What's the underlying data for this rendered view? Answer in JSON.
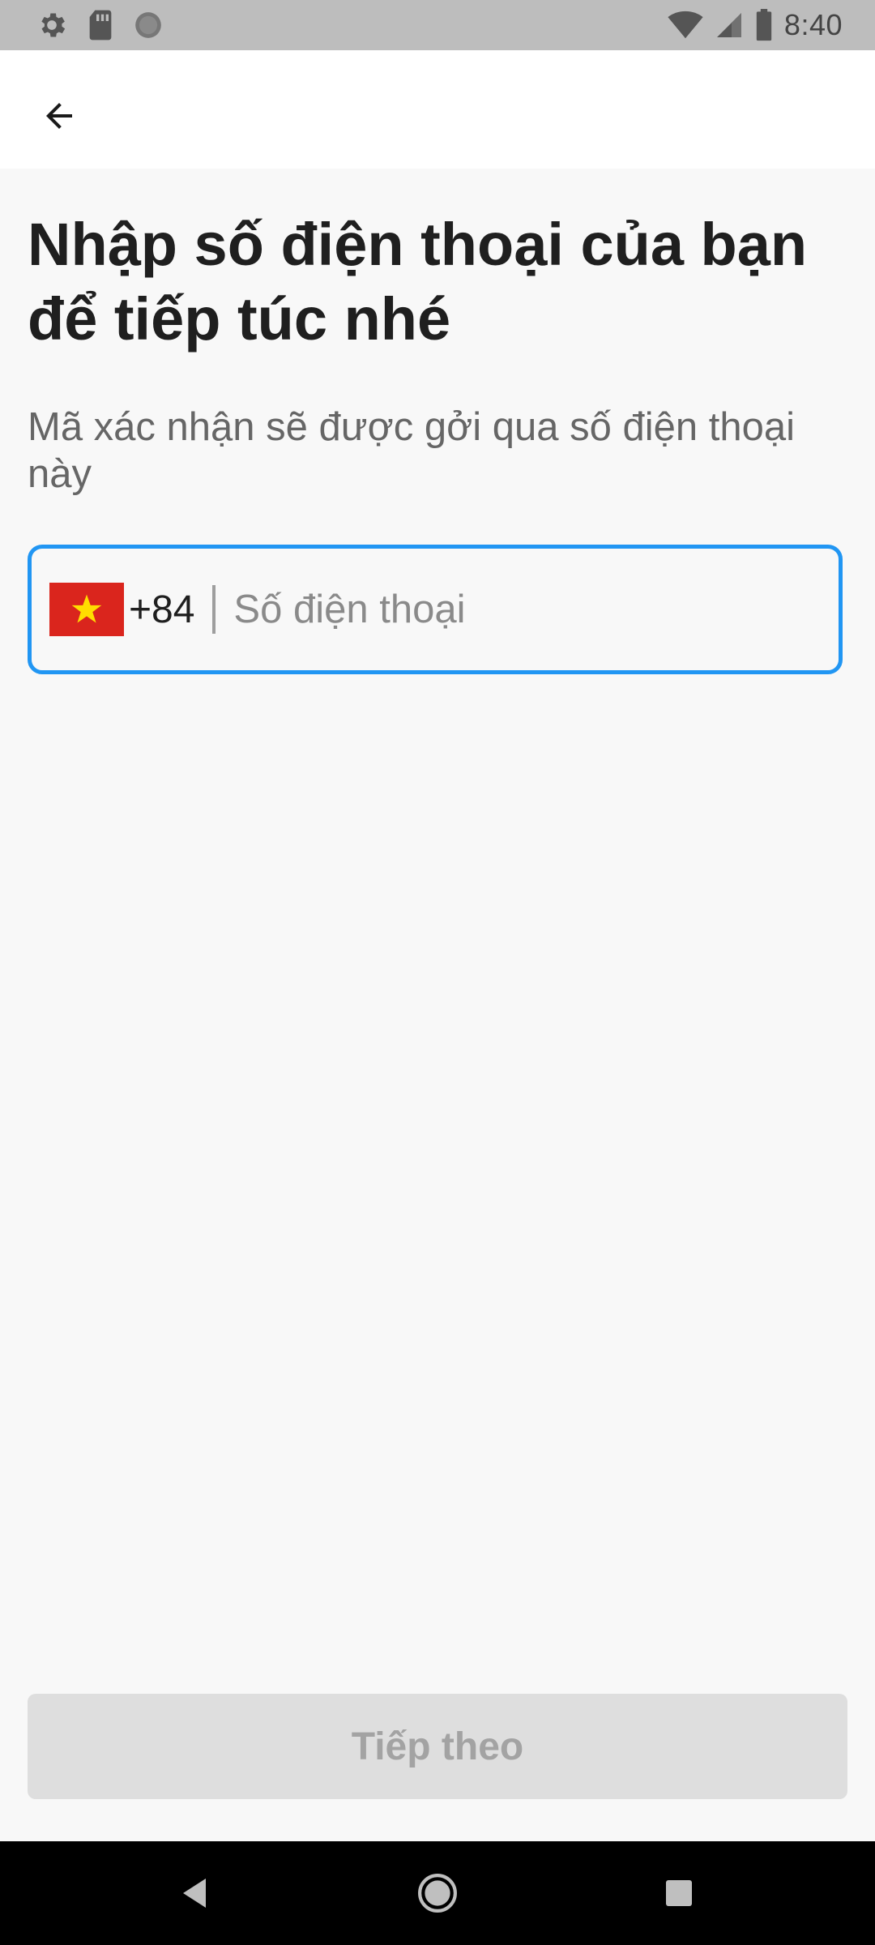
{
  "status_bar": {
    "time": "8:40",
    "left_icons": [
      "gear-icon",
      "sd-card-icon",
      "circle-status-icon"
    ],
    "right_icons": [
      "wifi-icon",
      "cellular-icon",
      "battery-icon"
    ]
  },
  "app_bar": {
    "back_icon": "arrow-left-icon"
  },
  "main": {
    "title": "Nhập số điện thoại của bạn để tiếp túc nhé",
    "subtitle": "Mã xác nhận sẽ được gởi qua số điện thoại này",
    "phone_field": {
      "country_flag": "vietnam-flag-icon",
      "dial_code": "+84",
      "placeholder": "Số điện thoại",
      "value": "",
      "border_color": "#2196f3"
    },
    "next_button": {
      "label": "Tiếp theo",
      "enabled": false
    }
  },
  "nav_bar": {
    "buttons": [
      "back-triangle-icon",
      "home-circle-icon",
      "recents-square-icon"
    ]
  }
}
